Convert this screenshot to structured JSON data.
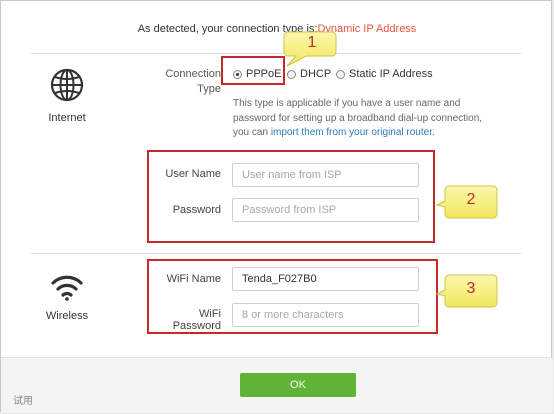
{
  "header": {
    "detected_prefix": "As detected, your connection type is:",
    "detected_type": "Dynamic IP Address"
  },
  "internet": {
    "icon": "globe-icon",
    "label": "Internet",
    "connection_type_label": "Connection Type",
    "options": [
      {
        "label": "PPPoE",
        "checked": true
      },
      {
        "label": "DHCP",
        "checked": false
      },
      {
        "label": "Static IP Address",
        "checked": false
      }
    ],
    "description_text": "This type is applicable if you have a user name and password for setting up a broadband dial-up connection, you can ",
    "description_link": "import them from your original router",
    "description_end": ".",
    "user_name_label": "User Name",
    "user_name_placeholder": "User name from ISP",
    "user_name_value": "",
    "password_label": "Password",
    "password_placeholder": "Password from ISP",
    "password_value": ""
  },
  "wireless": {
    "icon": "wifi-icon",
    "label": "Wireless",
    "wifi_name_label": "WiFi Name",
    "wifi_name_value": "Tenda_F027B0",
    "wifi_password_label": "WiFi Password",
    "wifi_password_placeholder": "8 or more characters",
    "wifi_password_value": ""
  },
  "annotations": {
    "callout_1": "1",
    "callout_2": "2",
    "callout_3": "3",
    "box_color": "#c42a2a",
    "callout_color": "#f8f38a"
  },
  "footer": {
    "ok_label": "OK",
    "ok_color": "#5fb336",
    "trial_mark": "试用"
  }
}
